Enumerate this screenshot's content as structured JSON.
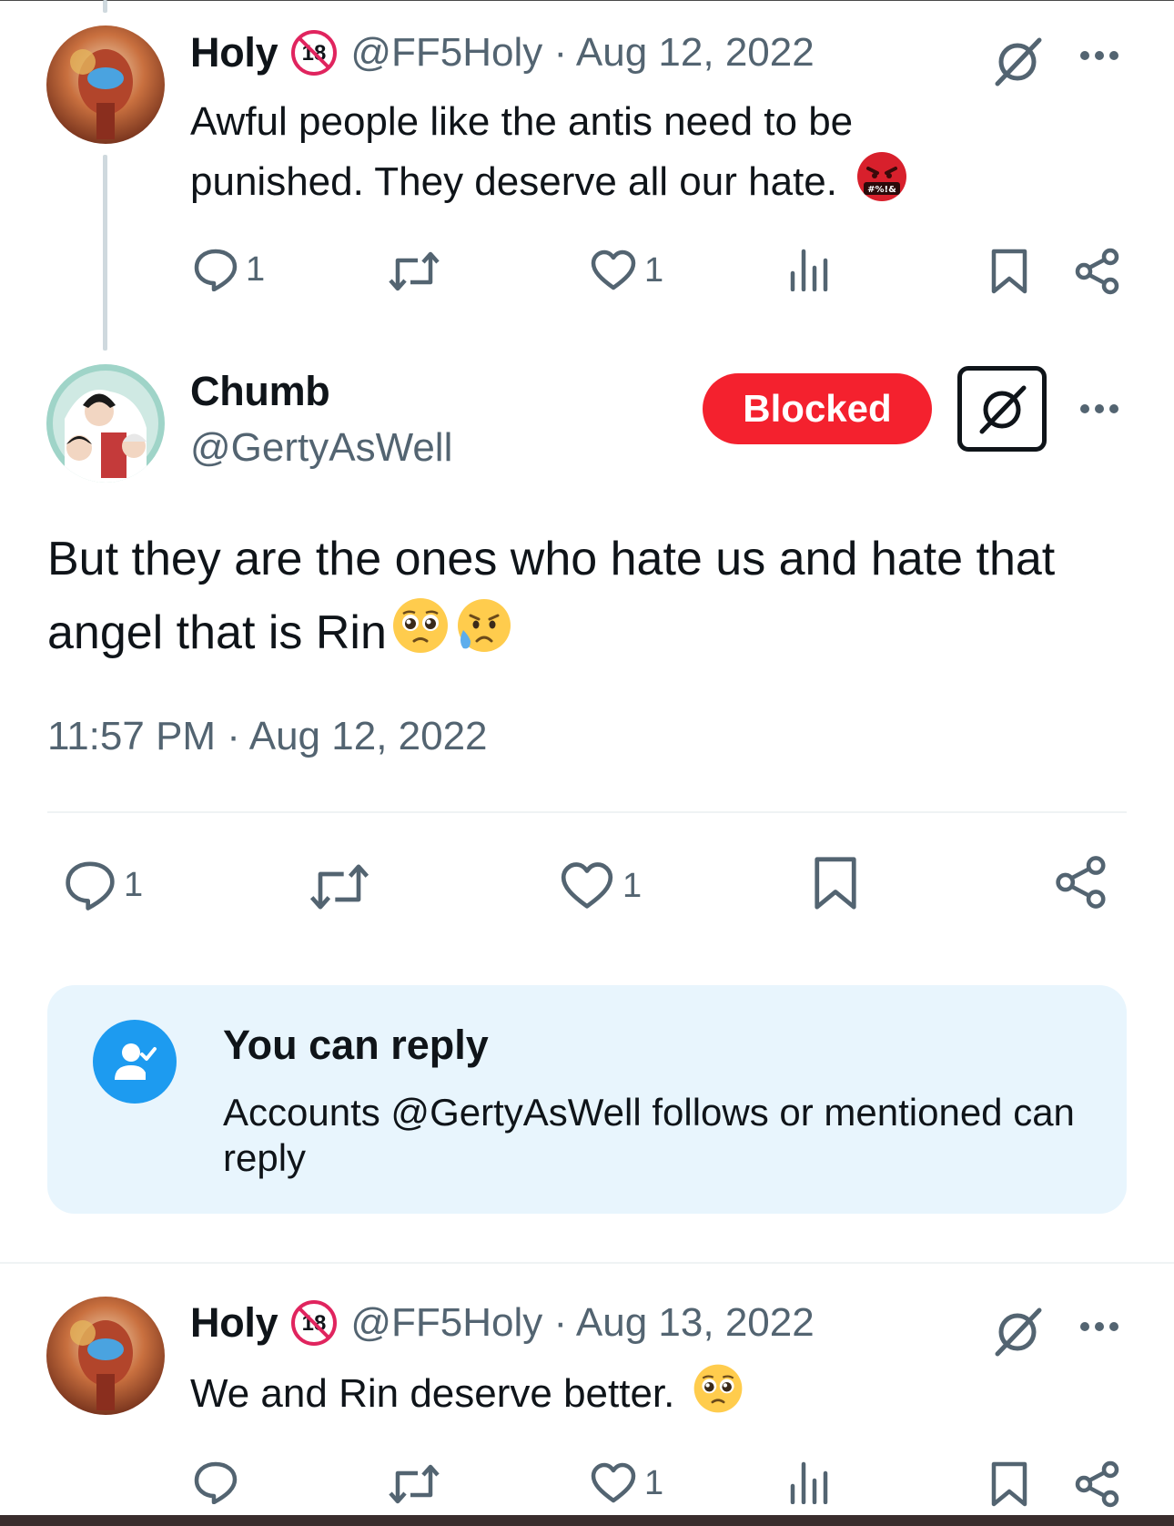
{
  "colors": {
    "text_primary": "#0f1419",
    "text_secondary": "#536471",
    "blocked_red": "#f4212e",
    "accent_blue": "#1d9bf0",
    "reply_card_bg": "#e8f5fd"
  },
  "tweet1": {
    "author_name": "Holy",
    "badge_text": "18",
    "meta": "@FF5Holy · Aug 12, 2022",
    "text": "Awful people like the antis need to be punished. They deserve all our hate.",
    "emoji_icon": "face-with-symbols-on-mouth-icon",
    "emoji_text": "#%!&",
    "reply_count": "1",
    "like_count": "1"
  },
  "main_tweet": {
    "author_name": "Chumb",
    "handle": "@GertyAsWell",
    "blocked_label": "Blocked",
    "text": "But they are the ones who hate us and hate that angel that is Rin",
    "emoji_icons": [
      "pleading-face-icon",
      "sad-but-relieved-face-icon"
    ],
    "timestamp": "11:57 PM · Aug 12, 2022",
    "reply_count": "1",
    "like_count": "1"
  },
  "reply_restriction": {
    "icon": "person-check-icon",
    "title": "You can reply",
    "description": "Accounts @GertyAsWell follows or mentioned can reply"
  },
  "tweet3": {
    "author_name": "Holy",
    "badge_text": "18",
    "meta": "@FF5Holy · Aug 13, 2022",
    "text": "We and Rin deserve better.",
    "emoji_icon": "pleading-face-icon",
    "like_count": "1"
  }
}
